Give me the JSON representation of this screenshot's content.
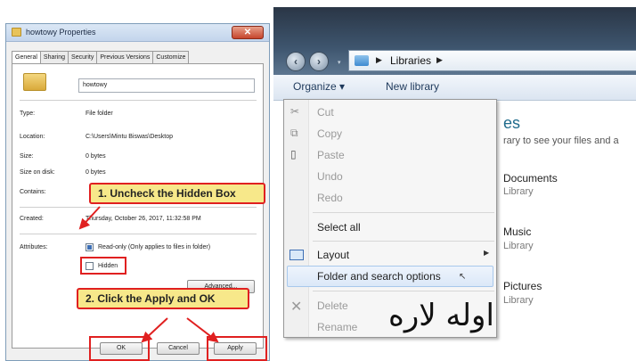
{
  "dialog": {
    "title": "howtowy Properties",
    "close_label": "✕",
    "tabs": [
      "General",
      "Sharing",
      "Security",
      "Previous Versions",
      "Customize"
    ],
    "folder_name": "howtowy",
    "rows": [
      {
        "label": "Type:",
        "value": "File folder"
      },
      {
        "label": "Location:",
        "value": "C:\\Users\\Mintu Biswas\\Desktop"
      },
      {
        "label": "Size:",
        "value": "0 bytes"
      },
      {
        "label": "Size on disk:",
        "value": "0 bytes"
      },
      {
        "label": "Contains:",
        "value": ""
      },
      {
        "label": "Created:",
        "value": "Thursday, October 26, 2017, 11:32:58 PM"
      }
    ],
    "attributes_label": "Attributes:",
    "readonly_label": "Read-only (Only applies to files in folder)",
    "hidden_label": "Hidden",
    "advanced_label": "Advanced...",
    "ok_label": "OK",
    "cancel_label": "Cancel",
    "apply_label": "Apply"
  },
  "callouts": {
    "step1": "1. Uncheck the Hidden Box",
    "step2": "2. Click the Apply and OK"
  },
  "explorer": {
    "breadcrumb": "Libraries",
    "organize_label": "Organize ▾",
    "new_library_label": "New library",
    "heading": "es",
    "subtitle": "rary to see your files and a",
    "libraries": [
      {
        "name": "Documents",
        "kind": "Library"
      },
      {
        "name": "Music",
        "kind": "Library"
      },
      {
        "name": "Pictures",
        "kind": "Library"
      }
    ]
  },
  "menu": {
    "items": {
      "cut": "Cut",
      "copy": "Copy",
      "paste": "Paste",
      "undo": "Undo",
      "redo": "Redo",
      "select_all": "Select all",
      "layout": "Layout",
      "folder_options": "Folder and search options",
      "delete": "Delete",
      "rename": "Rename"
    }
  },
  "overlay_text": "اوله لاره",
  "colors": {
    "callout_bg": "#f7e88a",
    "callout_border": "#e02020",
    "explorer_header": "#2a3646",
    "heading": "#1f6b8c"
  }
}
